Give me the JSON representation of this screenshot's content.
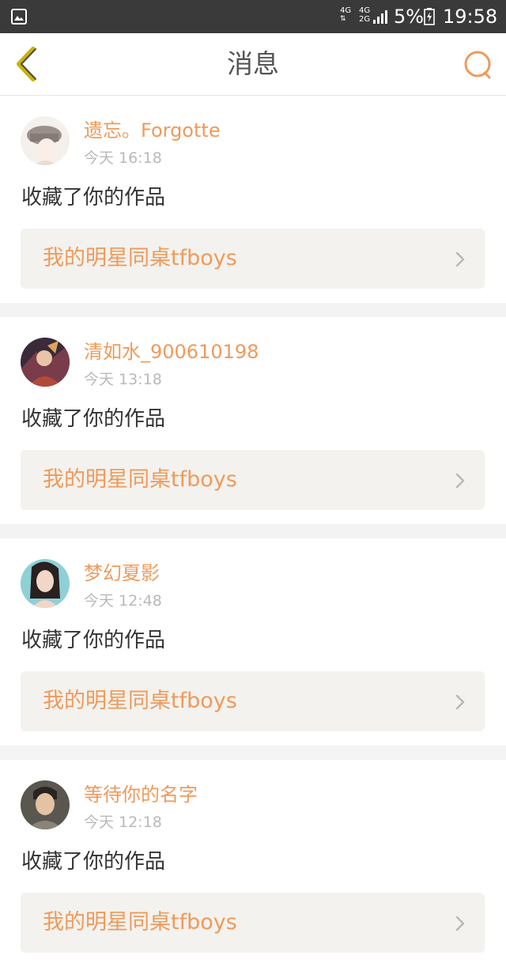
{
  "status_bar": {
    "network_1": "4G",
    "network_2_top": "4G",
    "network_2_bottom": "2G",
    "battery_percent": "5%",
    "time": "19:58"
  },
  "header": {
    "title": "消息",
    "back_icon": "chevron-left-icon",
    "search_icon": "search-icon"
  },
  "colors": {
    "accent": "#ef9a5b",
    "back_icon": "#c8b400",
    "status_bar": "#3a3a3a",
    "separator": "#f3f3f3",
    "link_bg": "#f3f2ee"
  },
  "messages": [
    {
      "user": "遗忘。Forgotte",
      "time": "今天 16:18",
      "action": "收藏了你的作品",
      "work": "我的明星同桌tfboys"
    },
    {
      "user": "清如水_900610198",
      "time": "今天 13:18",
      "action": "收藏了你的作品",
      "work": "我的明星同桌tfboys"
    },
    {
      "user": "梦幻夏影",
      "time": "今天 12:48",
      "action": "收藏了你的作品",
      "work": "我的明星同桌tfboys"
    },
    {
      "user": "等待你的名字",
      "time": "今天 12:18",
      "action": "收藏了你的作品",
      "work": "我的明星同桌tfboys"
    }
  ]
}
